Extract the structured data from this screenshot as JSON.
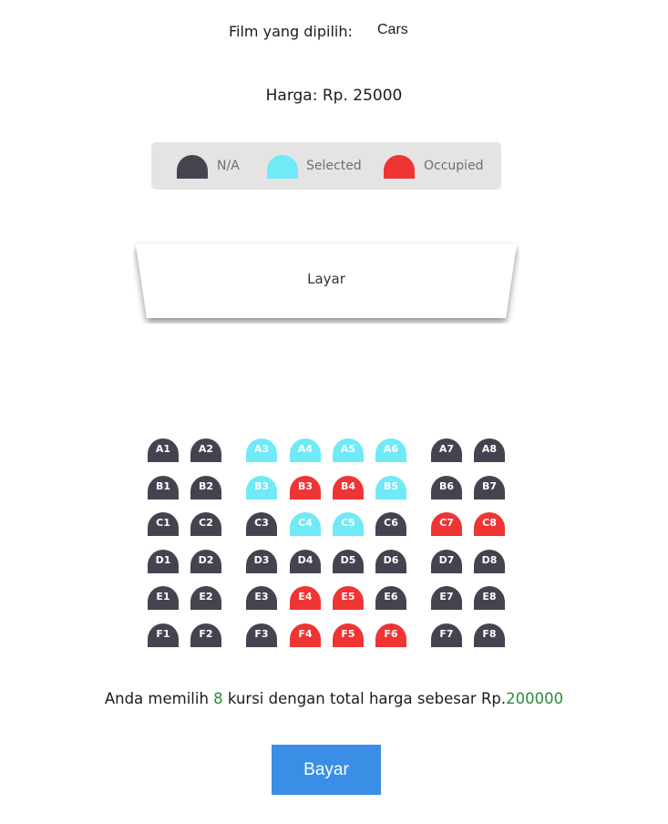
{
  "film": {
    "label": "Film yang dipilih:",
    "selected": "Cars"
  },
  "price": {
    "text": "Harga: Rp. 25000"
  },
  "legend": {
    "items": [
      {
        "label": "N/A",
        "color": "#444451"
      },
      {
        "label": "Selected",
        "color": "#6feaf6"
      },
      {
        "label": "Occupied",
        "color": "#ef3434"
      }
    ]
  },
  "screen": {
    "label": "Layar"
  },
  "seat_colors": {
    "na": "#444451",
    "selected": "#6feaf6",
    "occupied": "#ef3434"
  },
  "seats": {
    "rows": [
      {
        "row": "A",
        "seats": [
          {
            "id": "A1",
            "status": "na"
          },
          {
            "id": "A2",
            "status": "na"
          },
          {
            "id": "A3",
            "status": "selected"
          },
          {
            "id": "A4",
            "status": "selected"
          },
          {
            "id": "A5",
            "status": "selected"
          },
          {
            "id": "A6",
            "status": "selected"
          },
          {
            "id": "A7",
            "status": "na"
          },
          {
            "id": "A8",
            "status": "na"
          }
        ]
      },
      {
        "row": "B",
        "seats": [
          {
            "id": "B1",
            "status": "na"
          },
          {
            "id": "B2",
            "status": "na"
          },
          {
            "id": "B3",
            "status": "selected"
          },
          {
            "id": "B3",
            "status": "occupied"
          },
          {
            "id": "B4",
            "status": "occupied"
          },
          {
            "id": "B5",
            "status": "selected"
          },
          {
            "id": "B6",
            "status": "na"
          },
          {
            "id": "B7",
            "status": "na"
          }
        ]
      },
      {
        "row": "C",
        "seats": [
          {
            "id": "C1",
            "status": "na"
          },
          {
            "id": "C2",
            "status": "na"
          },
          {
            "id": "C3",
            "status": "na"
          },
          {
            "id": "C4",
            "status": "selected"
          },
          {
            "id": "C5",
            "status": "selected"
          },
          {
            "id": "C6",
            "status": "na"
          },
          {
            "id": "C7",
            "status": "occupied"
          },
          {
            "id": "C8",
            "status": "occupied"
          }
        ]
      },
      {
        "row": "D",
        "seats": [
          {
            "id": "D1",
            "status": "na"
          },
          {
            "id": "D2",
            "status": "na"
          },
          {
            "id": "D3",
            "status": "na"
          },
          {
            "id": "D4",
            "status": "na"
          },
          {
            "id": "D5",
            "status": "na"
          },
          {
            "id": "D6",
            "status": "na"
          },
          {
            "id": "D7",
            "status": "na"
          },
          {
            "id": "D8",
            "status": "na"
          }
        ]
      },
      {
        "row": "E",
        "seats": [
          {
            "id": "E1",
            "status": "na"
          },
          {
            "id": "E2",
            "status": "na"
          },
          {
            "id": "E3",
            "status": "na"
          },
          {
            "id": "E4",
            "status": "occupied"
          },
          {
            "id": "E5",
            "status": "occupied"
          },
          {
            "id": "E6",
            "status": "na"
          },
          {
            "id": "E7",
            "status": "na"
          },
          {
            "id": "E8",
            "status": "na"
          }
        ]
      },
      {
        "row": "F",
        "seats": [
          {
            "id": "F1",
            "status": "na"
          },
          {
            "id": "F2",
            "status": "na"
          },
          {
            "id": "F3",
            "status": "na"
          },
          {
            "id": "F4",
            "status": "occupied"
          },
          {
            "id": "F5",
            "status": "occupied"
          },
          {
            "id": "F6",
            "status": "occupied"
          },
          {
            "id": "F7",
            "status": "na"
          },
          {
            "id": "F8",
            "status": "na"
          }
        ]
      }
    ]
  },
  "summary": {
    "prefix": "Anda memilih ",
    "count": "8",
    "middle": " kursi dengan total harga sebesar Rp.",
    "total": "200000"
  },
  "pay_button": {
    "label": "Bayar"
  }
}
